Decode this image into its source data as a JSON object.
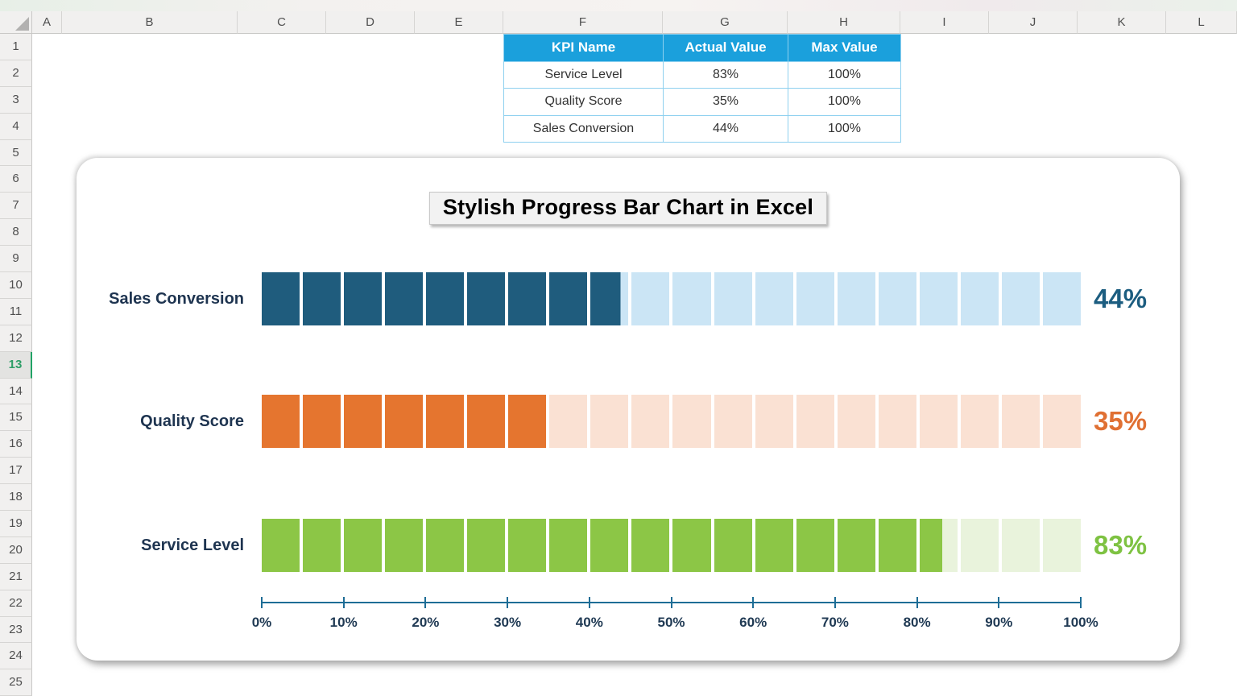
{
  "spreadsheet": {
    "select_all_label": "select-all",
    "columns": [
      "A",
      "B",
      "C",
      "D",
      "E",
      "F",
      "G",
      "H",
      "I",
      "J",
      "K",
      "L"
    ],
    "rows": [
      "1",
      "2",
      "3",
      "4",
      "5",
      "6",
      "7",
      "8",
      "9",
      "10",
      "11",
      "12",
      "13",
      "14",
      "15",
      "16",
      "17",
      "18",
      "19",
      "20",
      "21",
      "22",
      "23",
      "24",
      "25"
    ],
    "active_row": "13"
  },
  "kpi_table": {
    "headers": [
      "KPI Name",
      "Actual Value",
      "Max Value"
    ],
    "rows": [
      [
        "Service Level",
        "83%",
        "100%"
      ],
      [
        "Quality Score",
        "35%",
        "100%"
      ],
      [
        "Sales Conversion",
        "44%",
        "100%"
      ]
    ],
    "colors": {
      "header_bg": "#1BA0DC",
      "header_text": "#FFFFFF",
      "border": "#8ED0EF",
      "body_text": "#333333"
    }
  },
  "chart_data": {
    "type": "bar",
    "orientation": "horizontal",
    "title": "Stylish Progress Bar Chart in Excel",
    "categories": [
      "Sales Conversion",
      "Quality Score",
      "Service Level"
    ],
    "values": [
      44,
      35,
      83
    ],
    "xlim": [
      0,
      100
    ],
    "segment_count": 20,
    "segment_percent": 5,
    "grid": false,
    "legend": false,
    "axis_ticks": [
      "0%",
      "10%",
      "20%",
      "30%",
      "40%",
      "50%",
      "60%",
      "70%",
      "80%",
      "90%",
      "100%"
    ],
    "series": [
      {
        "name": "Sales Conversion",
        "value": 44,
        "value_label": "44%",
        "fill_color": "#1F5C7D",
        "remainder_color": "#CBE5F5",
        "value_color": "#1C5D80"
      },
      {
        "name": "Quality Score",
        "value": 35,
        "value_label": "35%",
        "fill_color": "#E5752F",
        "remainder_color": "#FAE1D3",
        "value_color": "#E07033"
      },
      {
        "name": "Service Level",
        "value": 83,
        "value_label": "83%",
        "fill_color": "#8CC646",
        "remainder_color": "#E9F3DC",
        "value_color": "#7EC242"
      }
    ],
    "colors": {
      "axis_line": "#1E6D96",
      "axis_label": "#203A54",
      "category_label": "#1E3450"
    }
  }
}
